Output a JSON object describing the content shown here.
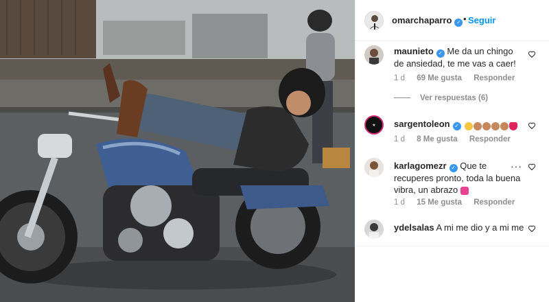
{
  "post": {
    "username": "omarchaparro",
    "dot": "•",
    "follow_label": "Seguir"
  },
  "comments": [
    {
      "username": "maunieto",
      "text": "Me da un chingo de ansiedad, te me vas a caer!",
      "time": "1 d",
      "likes": "69 Me gusta",
      "reply": "Responder",
      "view_replies": "Ver respuestas (6)"
    },
    {
      "username": "sargentoleon",
      "text": "",
      "time": "1 d",
      "likes": "8 Me gusta",
      "reply": "Responder"
    },
    {
      "username": "karlagomezr",
      "text": "Que te recuperes pronto, toda la buena vibra, un abrazo",
      "time": "1 d",
      "likes": "15 Me gusta",
      "reply": "Responder",
      "more": "···"
    },
    {
      "username": "ydelsalas",
      "text": "A mi me dio y a mi me"
    }
  ],
  "icons": {
    "verified": "verified-badge-icon",
    "heart": "heart-outline-icon",
    "emoji_sequence": [
      "hug-face",
      "clap",
      "clap",
      "clap",
      "clap",
      "red-heart"
    ],
    "kiss_emoji": "heart-with-ribbon"
  },
  "colors": {
    "link_blue": "#0095f6",
    "verified_blue": "#3897f0",
    "muted": "#8e8e8e",
    "text": "#262626"
  }
}
